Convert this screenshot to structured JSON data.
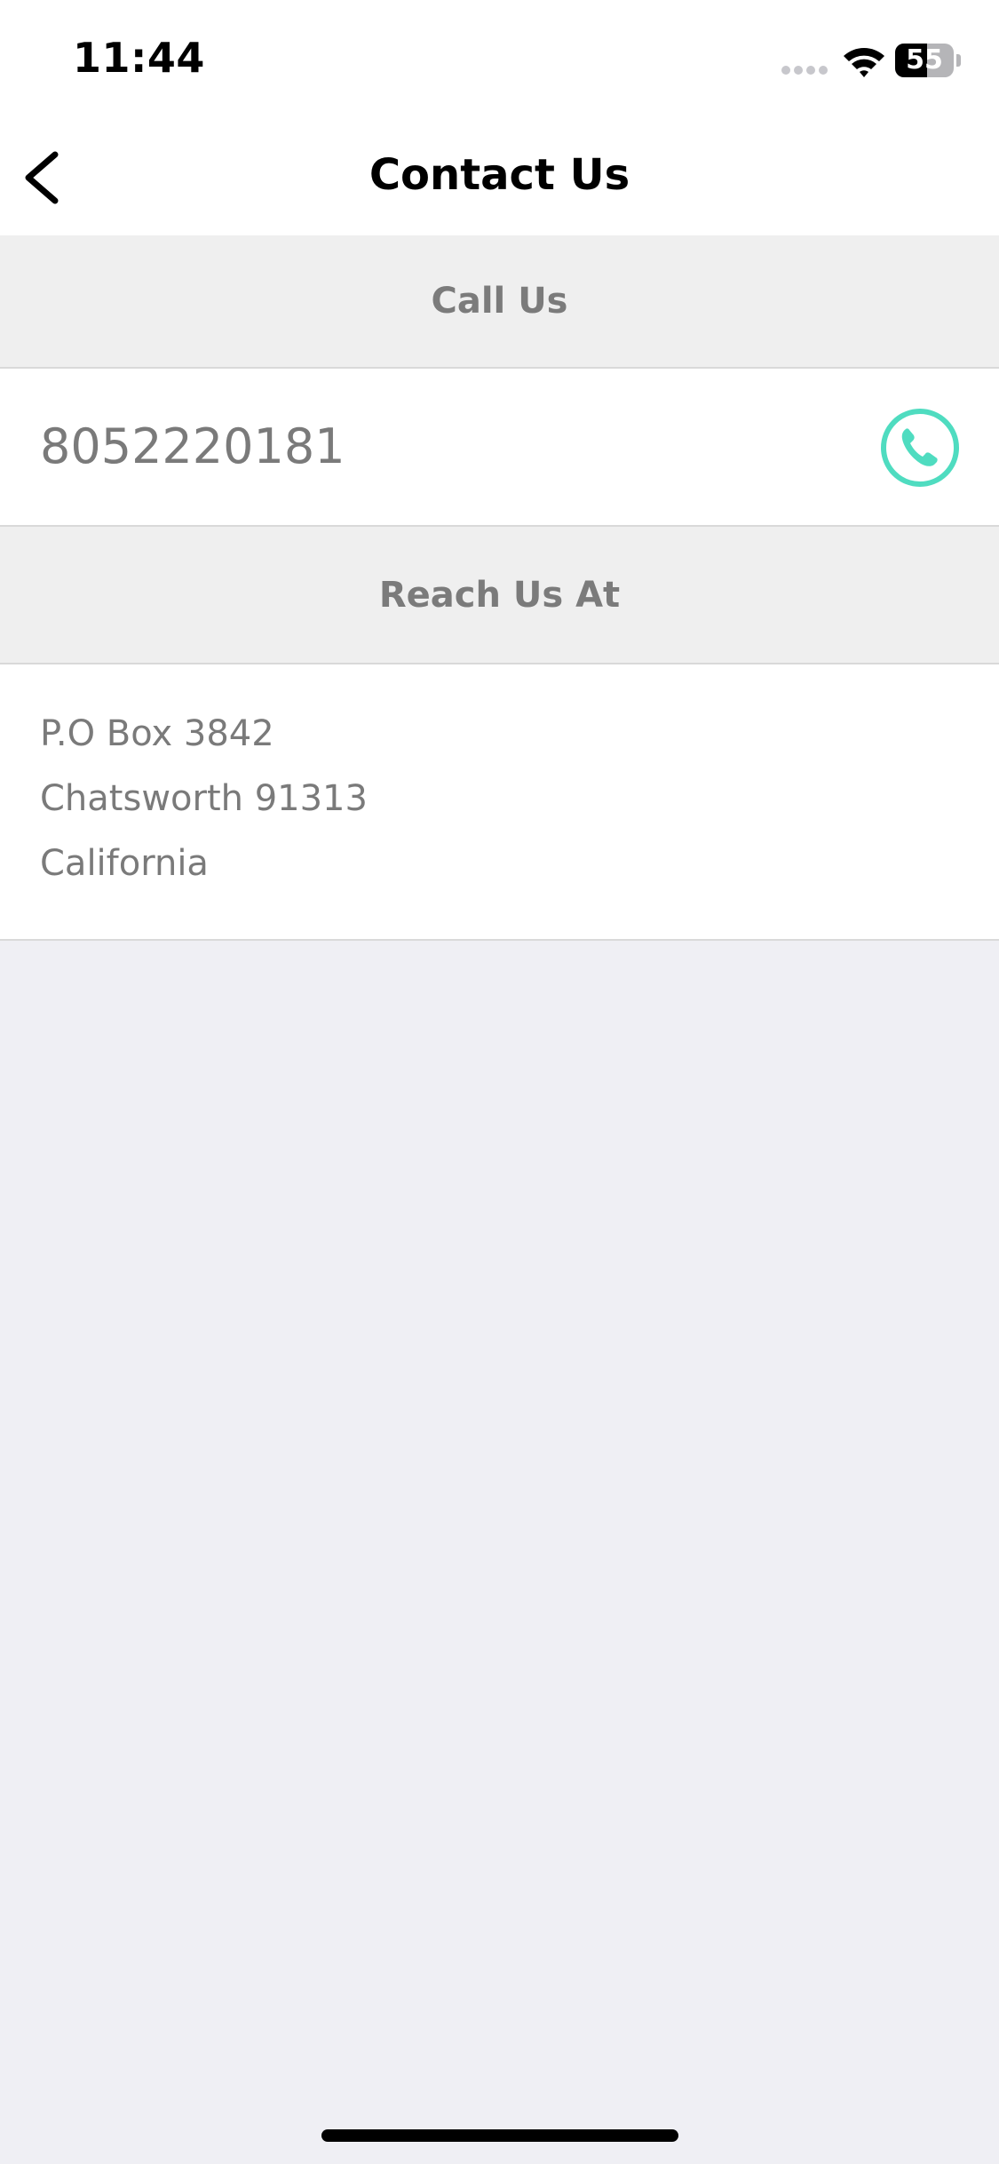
{
  "status_bar": {
    "time": "11:44",
    "battery_level": "55",
    "battery_percent": 55,
    "icons": [
      "signal-dots-icon",
      "wifi-icon",
      "battery-icon"
    ]
  },
  "nav": {
    "title": "Contact Us",
    "back_icon": "chevron-left-icon"
  },
  "call_section": {
    "header": "Call Us",
    "phone_number": "8052220181",
    "call_icon": "phone-icon",
    "accent_color": "#4fdcc0"
  },
  "reach_section": {
    "header": "Reach Us At",
    "address_lines": [
      "P.O Box 3842",
      "Chatsworth 91313",
      "California"
    ]
  },
  "colors": {
    "section_header_bg": "#efefef",
    "section_header_text": "#7b7b7b",
    "content_text": "#7a7a7a",
    "page_bg": "#efeff4"
  }
}
